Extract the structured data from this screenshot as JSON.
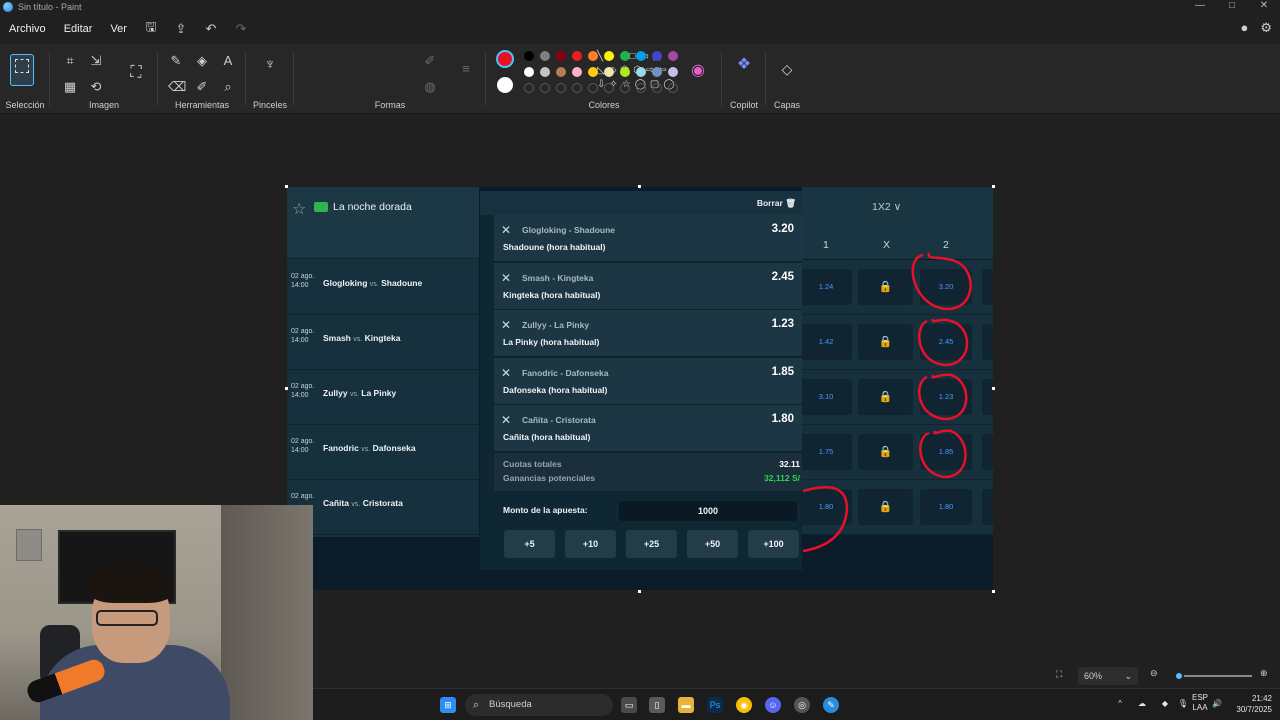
{
  "window": {
    "title": "Sin título - Paint"
  },
  "menu": {
    "items": [
      "Archivo",
      "Editar",
      "Ver"
    ]
  },
  "ribbon": {
    "groups": {
      "seleccion": "Selección",
      "imagen": "Imagen",
      "herramientas": "Herramientas",
      "pinceles": "Pinceles",
      "formas": "Formas",
      "colores": "Colores",
      "copilot": "Copilot",
      "capas": "Capas"
    },
    "palette_row1": [
      "#000000",
      "#7f7f7f",
      "#880015",
      "#ed1c24",
      "#ff7f27",
      "#fff200",
      "#22b14c",
      "#00a2e8",
      "#3f48cc",
      "#a349a4"
    ],
    "palette_row2": [
      "#ffffff",
      "#c3c3c3",
      "#b97a57",
      "#ffaec9",
      "#ffc90e",
      "#efe4b0",
      "#b5e61d",
      "#99d9ea",
      "#7092be",
      "#c8bfe7"
    ],
    "color1": "#e81123",
    "color2": "#ffffff"
  },
  "betting": {
    "league": "La noche dorada",
    "matches": [
      {
        "date": "02 ago.",
        "time": "14:00",
        "home": "Glogloking",
        "away": "Shadoune"
      },
      {
        "date": "02 ago.",
        "time": "14:00",
        "home": "Smash",
        "away": "Kingteka"
      },
      {
        "date": "02 ago.",
        "time": "14:00",
        "home": "Zullyy",
        "away": "La Pinky"
      },
      {
        "date": "02 ago.",
        "time": "14:00",
        "home": "Fanodric",
        "away": "Dafonseka"
      },
      {
        "date": "02 ago.",
        "time": "",
        "home": "Cañita",
        "away": "Cristorata"
      }
    ],
    "vs_label": "vs.",
    "betslip": {
      "clear_label": "Borrar",
      "items": [
        {
          "event": "Glogloking - Shadoune",
          "selection": "Shadoune (hora habitual)",
          "odds": "3.20"
        },
        {
          "event": "Smash - Kingteka",
          "selection": "Kingteka (hora habitual)",
          "odds": "2.45"
        },
        {
          "event": "Zullyy - La Pinky",
          "selection": "La Pinky (hora habitual)",
          "odds": "1.23"
        },
        {
          "event": "Fanodric - Dafonseka",
          "selection": "Dafonseka (hora habitual)",
          "odds": "1.85"
        },
        {
          "event": "Cañita - Cristorata",
          "selection": "Cañita (hora habitual)",
          "odds": "1.80"
        }
      ],
      "total_odds_label": "Cuotas totales",
      "total_odds": "32.11",
      "potential_label": "Ganancias potenciales",
      "potential": "32,112 S/",
      "stake_label": "Monto de la apuesta:",
      "stake_value": "1000",
      "quick_amounts": [
        "+5",
        "+10",
        "+25",
        "+50",
        "+100"
      ]
    },
    "market": "1X2 ∨",
    "columns": [
      "1",
      "X",
      "2"
    ],
    "odds_rows": [
      {
        "home": "1.24",
        "away": "3.20"
      },
      {
        "home": "1.42",
        "away": "2.45"
      },
      {
        "home": "3.10",
        "away": "1.23"
      },
      {
        "home": "1.75",
        "away": "1.85"
      },
      {
        "home": "1.80",
        "away": "1.80"
      }
    ],
    "accent_odds": "#4a9bff",
    "accent_win": "#2bd64f"
  },
  "status": {
    "zoom": "60%"
  },
  "taskbar": {
    "search": "Búsqueda",
    "lang1": "ESP",
    "lang2": "LAA",
    "time": "21:42",
    "date": "30/7/2025"
  }
}
